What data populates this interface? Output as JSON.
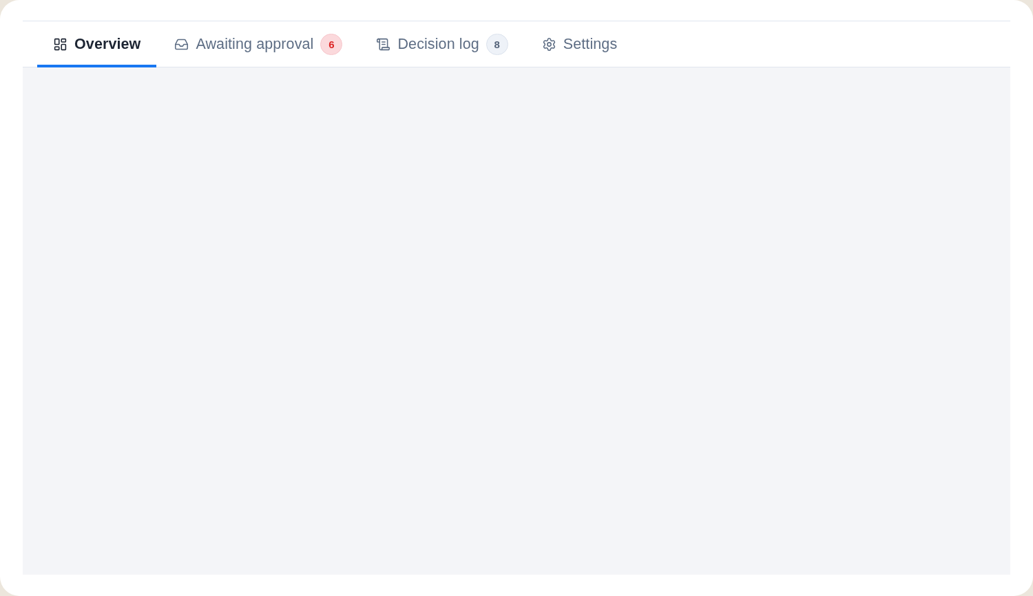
{
  "tabs": [
    {
      "label": "Overview",
      "selected": true
    },
    {
      "label": "Awaiting approval",
      "selected": false,
      "badge": {
        "count": "6",
        "kind": "alert"
      }
    },
    {
      "label": "Decision log",
      "selected": false,
      "badge": {
        "count": "8",
        "kind": "neutral"
      }
    },
    {
      "label": "Settings",
      "selected": false
    }
  ]
}
